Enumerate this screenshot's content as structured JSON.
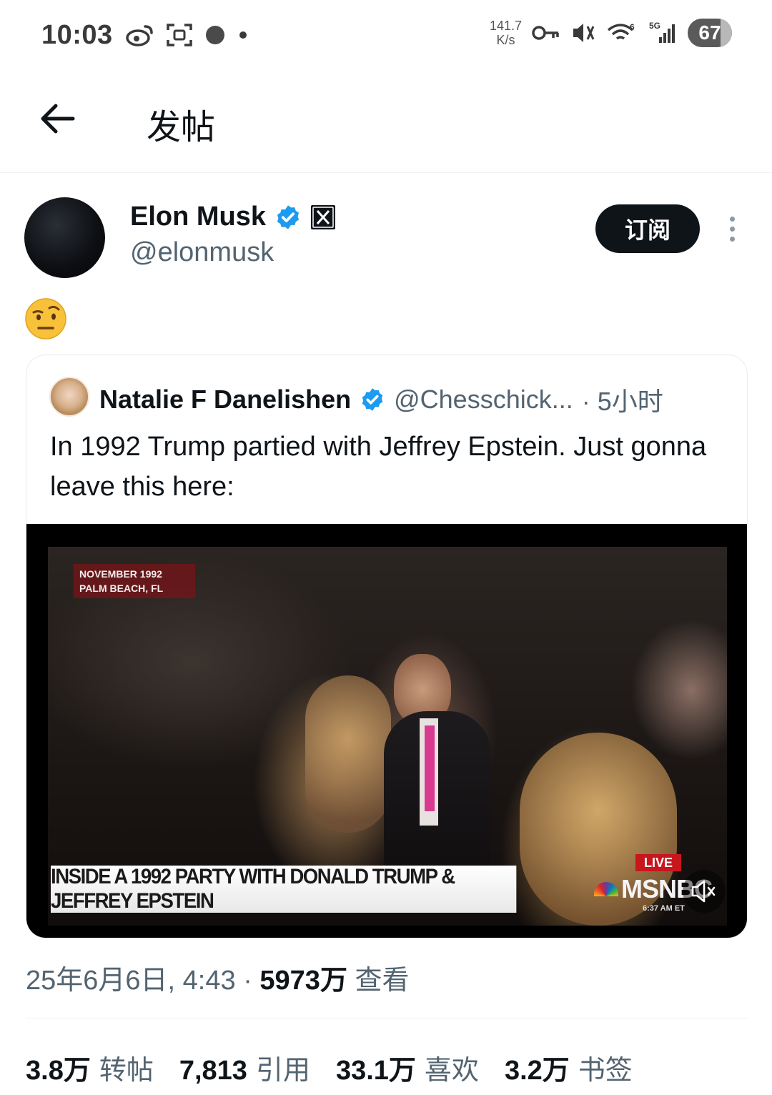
{
  "status_bar": {
    "time": "10:03",
    "net_speed_value": "141.7",
    "net_speed_unit": "K/s",
    "signal_label": "5G",
    "wifi_label": "6",
    "battery": "67"
  },
  "header": {
    "title": "发帖"
  },
  "post": {
    "author_name": "Elon Musk",
    "author_handle": "@elonmusk",
    "subscribe_label": "订阅",
    "emoji": "🤨",
    "timestamp": "25年6月6日, 4:43",
    "separator": "·",
    "views_count": "5973万",
    "views_label": "查看"
  },
  "quote": {
    "author_name": "Natalie F Danelishen",
    "author_handle": "@Chesschick...",
    "time": "· 5小时",
    "text": "In 1992 Trump partied with Jeffrey Epstein. Just gonna leave this here:",
    "video": {
      "dateline_1": "NOVEMBER 1992",
      "dateline_2": "PALM BEACH, FL",
      "headline": "INSIDE A 1992 PARTY WITH DONALD TRUMP & JEFFREY EPSTEIN",
      "live": "LIVE",
      "network": "MSNBC",
      "clock": "6:37 AM ET"
    }
  },
  "stats": [
    {
      "value": "3.8万",
      "label": "转帖"
    },
    {
      "value": "7,813",
      "label": "引用"
    },
    {
      "value": "33.1万",
      "label": "喜欢"
    },
    {
      "value": "3.2万",
      "label": "书签"
    }
  ],
  "colors": {
    "verified_blue": "#1d9bf0",
    "text_primary": "#0f1419",
    "text_secondary": "#536471"
  }
}
